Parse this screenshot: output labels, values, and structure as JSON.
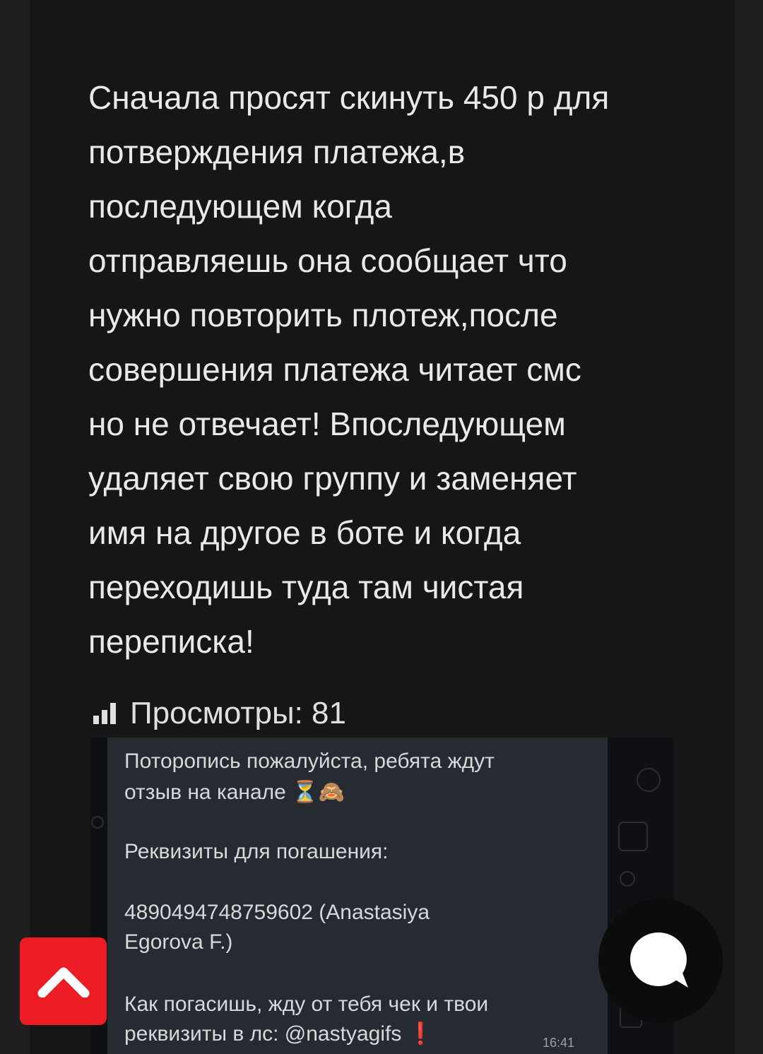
{
  "post": {
    "text": "Сначала просят скинуть 450 р для\nпотверждения платежа,в\nпоследующем когда\nотправляешь она сообщает что\nнужно повторить плотеж,после\nсовершения платежа читает смс\nно не отвечает! Впоследующем\nудаляет свою группу и заменяет\nимя на другое в боте и когда\nпереходишь туда там чистая\nпереписка!",
    "views_label": "Просмотры: 81"
  },
  "screenshot": {
    "line1": "Поторопись пожалуйста, ребята ждут",
    "line2": "отзыв на канале ⏳🙈",
    "line3": "Реквизиты для погашения:",
    "line4": "4890494748759602 (Anastasiya",
    "line5": "Egorova F.)",
    "line6": "Как погасишь, жду от тебя чек и твои",
    "line7": "реквизиты в лс: @nastyagifs ❗",
    "time": "16:41"
  },
  "icons": {
    "views": "bar-chart-icon",
    "scroll_up": "chevron-up-icon",
    "chat": "chat-bubble-icon"
  },
  "colors": {
    "page_bg": "#1f1f1f",
    "card_bg": "#161616",
    "text": "#e9e9e9",
    "scroll_button": "#ec1c24",
    "chat_button": "#0c0c0c"
  }
}
